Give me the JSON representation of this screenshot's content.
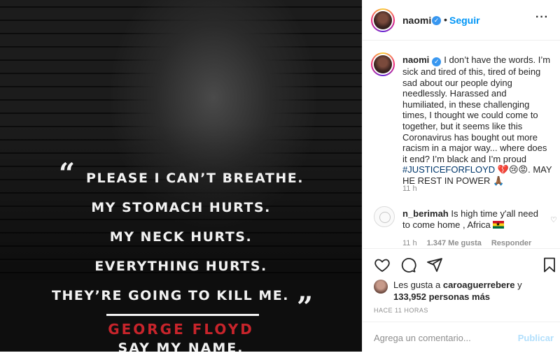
{
  "post_image": {
    "quote_lines": [
      "PLEASE I CAN’T BREATHE.",
      "MY STOMACH HURTS.",
      "MY NECK HURTS.",
      "EVERYTHING HURTS.",
      "THEY’RE GOING TO KILL ME."
    ],
    "open_quote": "“",
    "close_quote": "”",
    "attribution": "GEORGE FLOYD",
    "tagline": "SAY MY NAME."
  },
  "header": {
    "username": "naomi",
    "separator": "•",
    "follow_label": "Seguir",
    "more_icon": "more-horizontal-icon"
  },
  "caption": {
    "username": "naomi",
    "text": "I don’t have the words. I’m sick and tired of this, tired of being sad about our people dying needlessly. Harassed and humiliated, in these challenging times, I thought we could come to together, but it seems like this Coronavirus has bought out more racism in a major way... where does it end? I’m black and I’m proud ",
    "hashtag": "#JUSTICEFORFLOYD",
    "emojis": "💔😢😡",
    "closing": ". MAY HE REST IN POWER ",
    "closing_emoji": "🙏🏾",
    "time": "11 h"
  },
  "comment": {
    "username": "n_berimah",
    "text": "Is high time y'all need to come home , Africa ",
    "time": "11 h",
    "likes": "1.347 Me gusta",
    "reply_label": "Responder"
  },
  "actions": {
    "icons": [
      "heart-icon",
      "comment-icon",
      "share-icon",
      "bookmark-icon"
    ]
  },
  "likes": {
    "prefix": "Les gusta a",
    "user": "caroaguerrebere",
    "connector": "y",
    "count": "133,952 personas más"
  },
  "timestamp": "HACE 11 HORAS",
  "add_comment": {
    "placeholder": "Agrega un comentario...",
    "publish_label": "Publicar"
  },
  "colors": {
    "accent": "#0095f6",
    "attribution_red": "#c8242b",
    "publish_disabled": "#b2dffc"
  }
}
